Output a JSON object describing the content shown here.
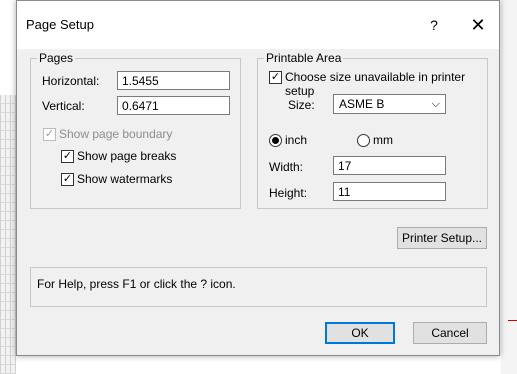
{
  "dialog": {
    "title": "Page Setup",
    "help_glyph": "?",
    "close_glyph": "✕"
  },
  "pages": {
    "legend": "Pages",
    "horizontal_label": "Horizontal:",
    "horizontal_value": "1.5455",
    "vertical_label": "Vertical:",
    "vertical_value": "0.6471",
    "show_page_boundary_label": "Show page boundary",
    "show_page_boundary_checked": true,
    "show_page_boundary_enabled": false,
    "show_page_breaks_label": "Show page breaks",
    "show_page_breaks_checked": true,
    "show_watermarks_label": "Show watermarks",
    "show_watermarks_checked": true
  },
  "printable_area": {
    "legend": "Printable Area",
    "choose_size_label": "Choose size unavailable in printer setup",
    "choose_size_checked": true,
    "size_label": "Size:",
    "size_value": "ASME B",
    "units": {
      "inch_label": "inch",
      "mm_label": "mm",
      "selected": "inch"
    },
    "width_label": "Width:",
    "width_value": "17",
    "height_label": "Height:",
    "height_value": "11"
  },
  "buttons": {
    "printer_setup": "Printer Setup...",
    "ok": "OK",
    "cancel": "Cancel"
  },
  "status_text": "For Help, press F1 or click the ? icon.",
  "icons": {
    "check": "✓",
    "chevron": "⌵"
  }
}
